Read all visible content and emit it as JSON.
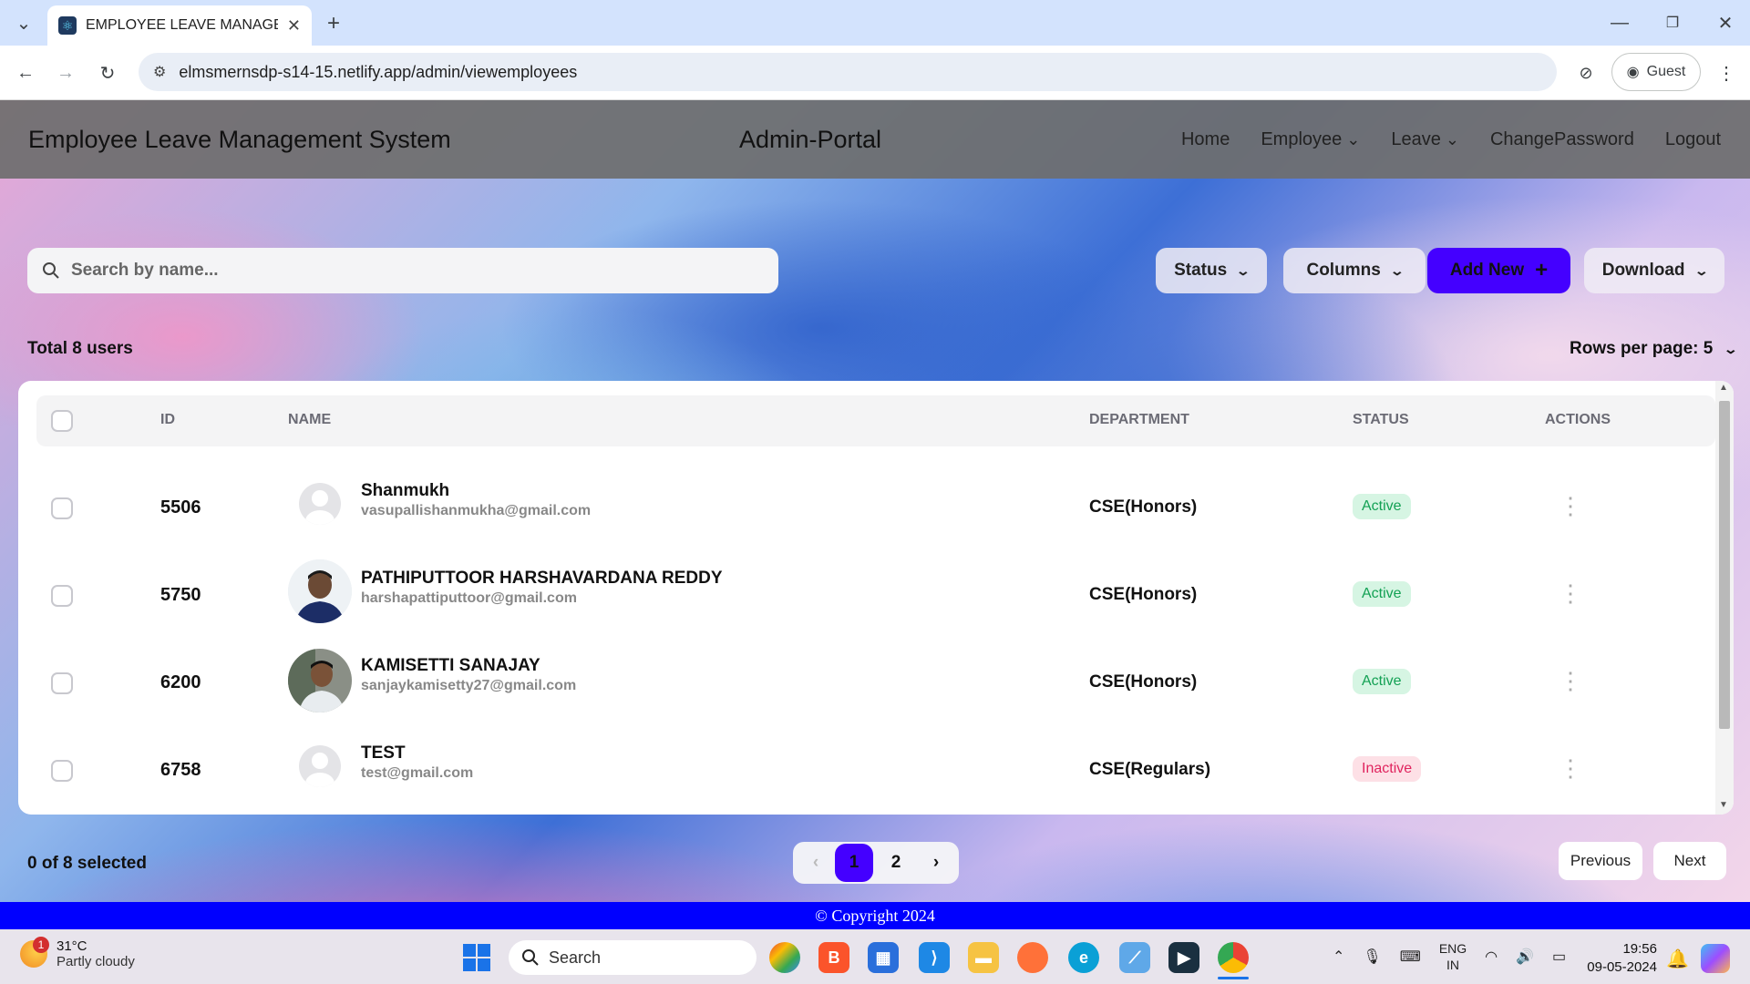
{
  "browser": {
    "tab_title": "EMPLOYEE LEAVE MANAGEMEN",
    "url": "elmsmernsdp-s14-15.netlify.app/admin/viewemployees",
    "profile": "Guest"
  },
  "navbar": {
    "brand": "Employee Leave Management System",
    "portal": "Admin-Portal",
    "links": [
      "Home",
      "Employee",
      "Leave",
      "ChangePassword",
      "Logout"
    ]
  },
  "controls": {
    "search_placeholder": "Search by name...",
    "status_label": "Status",
    "columns_label": "Columns",
    "add_label": "Add New",
    "download_label": "Download",
    "total_text": "Total 8 users",
    "rows_per_page": "Rows per page: 5"
  },
  "table": {
    "headers": [
      "ID",
      "NAME",
      "DEPARTMENT",
      "STATUS",
      "ACTIONS"
    ],
    "rows": [
      {
        "id": "5506",
        "name": "Shanmukh",
        "email": "vasupallishanmukha@gmail.com",
        "department": "CSE(Honors)",
        "status": "Active"
      },
      {
        "id": "5750",
        "name": "PATHIPUTTOOR HARSHAVARDANA REDDY",
        "email": "harshapattiputtoor@gmail.com",
        "department": "CSE(Honors)",
        "status": "Active"
      },
      {
        "id": "6200",
        "name": "KAMISETTI SANAJAY",
        "email": "sanjaykamisetty27@gmail.com",
        "department": "CSE(Honors)",
        "status": "Active"
      },
      {
        "id": "6758",
        "name": "TEST",
        "email": "test@gmail.com",
        "department": "CSE(Regulars)",
        "status": "Inactive"
      }
    ]
  },
  "pagination": {
    "selected_text": "0 of 8 selected",
    "pages": [
      "1",
      "2"
    ],
    "previous": "Previous",
    "next": "Next"
  },
  "footer": "© Copyright 2024",
  "taskbar": {
    "weather_temp": "31°C",
    "weather_desc": "Partly cloudy",
    "weather_badge": "1",
    "search": "Search",
    "lang1": "ENG",
    "lang2": "IN",
    "time": "19:56",
    "date": "09-05-2024"
  },
  "colors": {
    "accent": "#4400ff",
    "footer": "#0000ff",
    "active_chip": "#13a154",
    "inactive_chip": "#e0245e"
  }
}
